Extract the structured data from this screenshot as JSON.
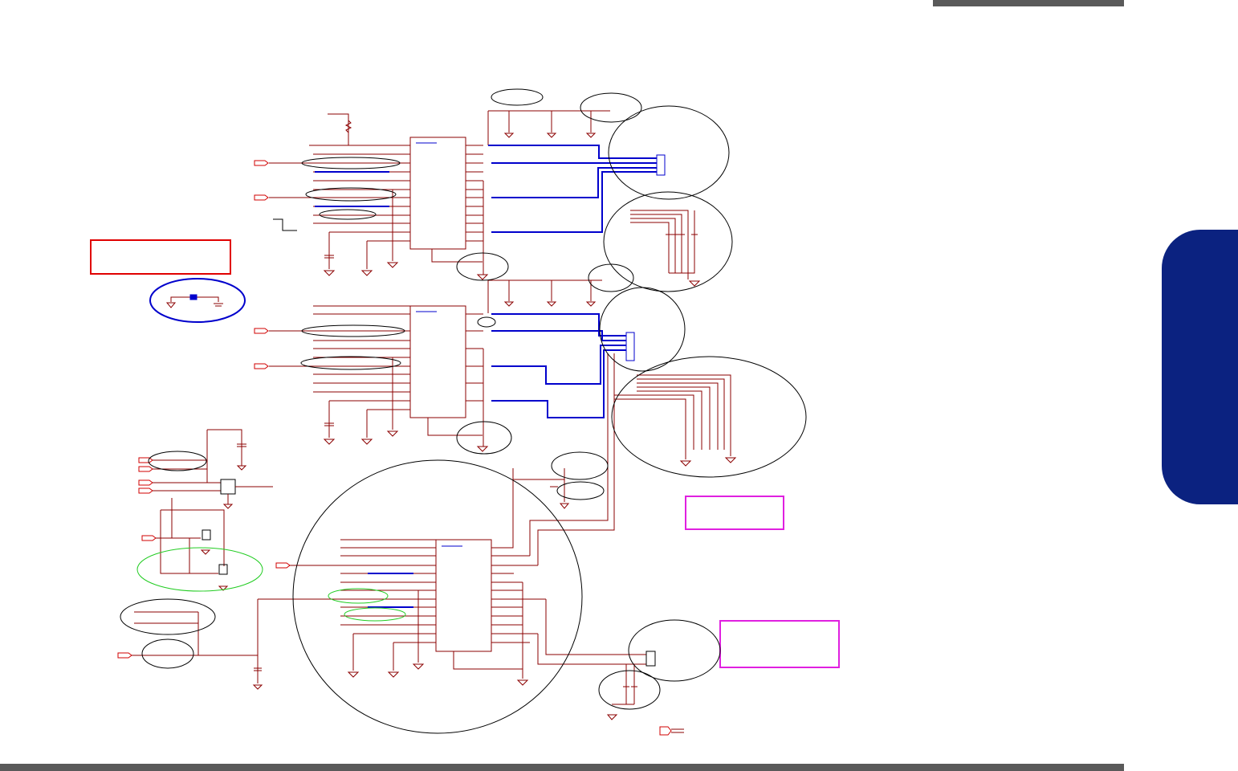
{
  "page": {
    "header_bar_color": "#5a5a5a",
    "footer_bar_color": "#5a5a5a",
    "side_tab_color": "#0b2280"
  },
  "schematic": {
    "wire_color": "#8b0000",
    "bus_color": "#0000cc",
    "annotation_circle_color": "#000000",
    "highlight_green": "#22cc22",
    "highlight_blue": "#0000cc",
    "note_red_border": "#e00000",
    "note_magenta_border": "#e020e0",
    "port_color": "#d00000",
    "ic_blocks": [
      "upper-ic",
      "middle-ic",
      "lower-ic"
    ],
    "connectors": [
      "upper-connector",
      "middle-connector",
      "lower-connector"
    ]
  }
}
